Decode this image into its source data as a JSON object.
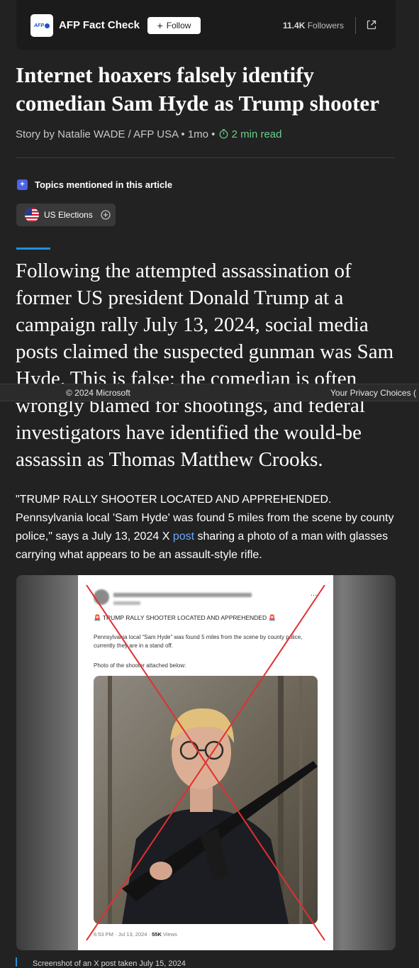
{
  "publisher": {
    "logo_text": "AFP",
    "name": "AFP Fact Check",
    "follow_label": "Follow",
    "followers_count": "11.4K",
    "followers_label": "Followers"
  },
  "article": {
    "headline": "Internet hoaxers falsely identify comedian Sam Hyde as Trump shooter",
    "byline": "Story by Natalie WADE / AFP USA • 1mo •",
    "read_time": "2 min read"
  },
  "topics": {
    "heading": "Topics mentioned in this article",
    "chips": [
      {
        "label": "US Elections",
        "icon": "us-flag-icon"
      }
    ]
  },
  "lead": {
    "before": "Following the attempted assassination of former US president Donald Trump at a campaign rally July 13, 2024, social media posts claimed the suspected gunman was Sam Hyde. This is false: the comedian is often",
    "after": "wrongly blamed for shootings, and federal investigators have identified the would-be assassin as Thomas Matthew Crooks."
  },
  "footer": {
    "copyright": "© 2024 Microsoft",
    "privacy": "Your Privacy Choices ("
  },
  "body": {
    "text_before_link": "\"TRUMP RALLY SHOOTER LOCATED AND APPREHENDED. Pennsylvania local 'Sam Hyde' was found 5 miles from the scene by county police,\" says a July 13, 2024 X ",
    "link_text": "post",
    "text_after_link": " sharing a photo of a man with glasses carrying what appears to be an assault-style rifle."
  },
  "figure": {
    "tweet_headline": "TRUMP RALLY SHOOTER LOCATED AND APPREHENDED",
    "tweet_body": "Pennsylvania local “Sam Hyde” was found 5 miles from the scene by county police, currently they are in a stand off.",
    "tweet_photo_label": "Photo of the shooter attached below:",
    "tweet_time": "6:53 PM · Jul 13, 2024 ·",
    "tweet_views_count": "55K",
    "tweet_views_label": "Views",
    "tweet_more": "...",
    "caption": "Screenshot of an X post taken July 15, 2024"
  },
  "colors": {
    "background": "#222222",
    "accent_blue": "#1e90e0",
    "read_time_green": "#6bd08e",
    "link_blue": "#6aa6ff",
    "debunk_cross": "#e03030"
  }
}
